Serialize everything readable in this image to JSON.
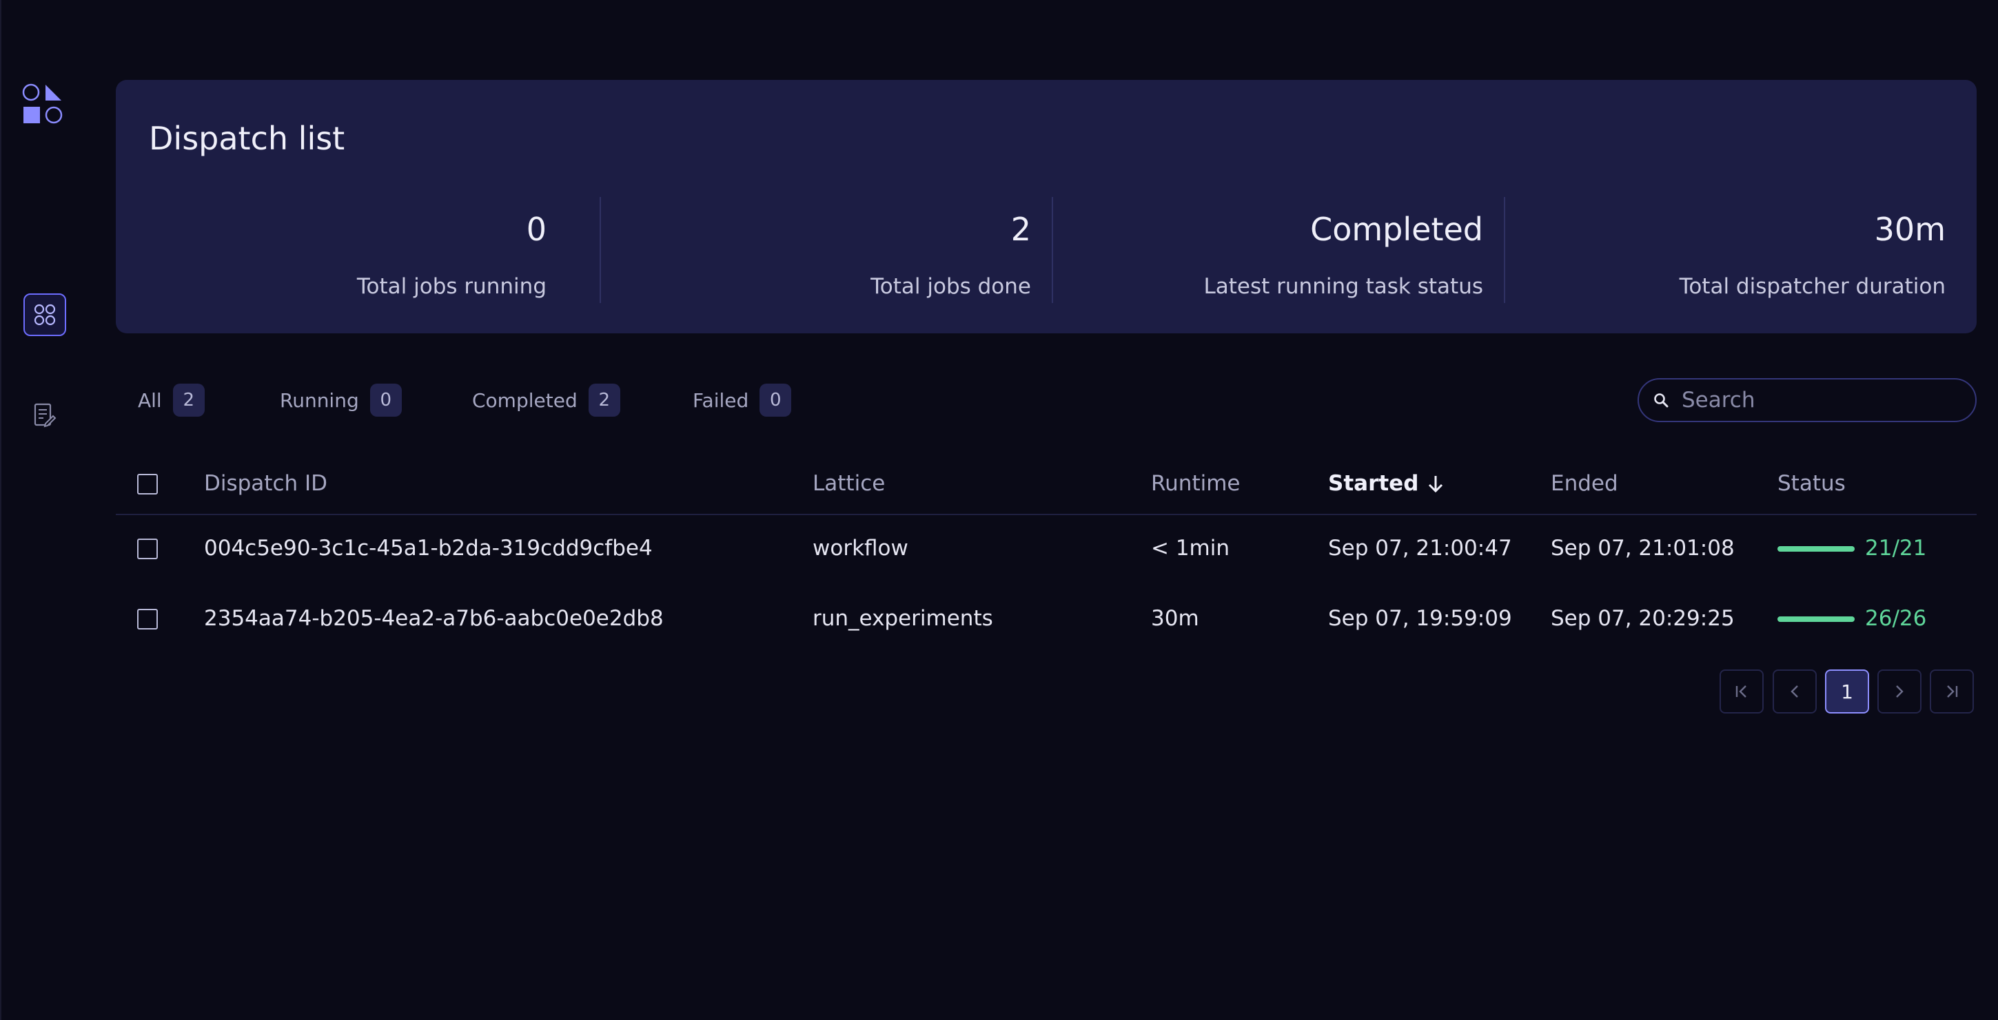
{
  "sidebar": {
    "logo_icon": "covalent-logo-icon",
    "items": [
      {
        "icon": "dispatch-list-icon",
        "active": true
      },
      {
        "icon": "logs-icon",
        "active": false
      }
    ]
  },
  "summary": {
    "title": "Dispatch list",
    "stats": [
      {
        "value": "0",
        "label": "Total jobs running"
      },
      {
        "value": "2",
        "label": "Total jobs done"
      },
      {
        "value": "Completed",
        "label": "Latest running task status"
      },
      {
        "value": "30m",
        "label": "Total dispatcher duration"
      }
    ]
  },
  "filters": [
    {
      "label": "All",
      "count": "2"
    },
    {
      "label": "Running",
      "count": "0"
    },
    {
      "label": "Completed",
      "count": "2"
    },
    {
      "label": "Failed",
      "count": "0"
    }
  ],
  "search": {
    "placeholder": "Search",
    "value": ""
  },
  "table": {
    "columns": {
      "dispatch_id": "Dispatch ID",
      "lattice": "Lattice",
      "runtime": "Runtime",
      "started": "Started",
      "ended": "Ended",
      "status": "Status"
    },
    "sorted_column": "started",
    "sort_direction": "descending",
    "rows": [
      {
        "dispatch_id": "004c5e90-3c1c-45a1-b2da-319cdd9cfbe4",
        "lattice": "workflow",
        "runtime": "< 1min",
        "started": "Sep 07, 21:00:47",
        "ended": "Sep 07, 21:01:08",
        "status": "21/21",
        "progress": 1.0
      },
      {
        "dispatch_id": "2354aa74-b205-4ea2-a7b6-aabc0e0e2db8",
        "lattice": "run_experiments",
        "runtime": "30m",
        "started": "Sep 07, 19:59:09",
        "ended": "Sep 07, 20:29:25",
        "status": "26/26",
        "progress": 1.0
      }
    ]
  },
  "pagination": {
    "current_page": "1"
  },
  "colors": {
    "background": "#0a0a17",
    "card": "#1c1d44",
    "accent": "#6d6dff",
    "success": "#5fd69a"
  }
}
